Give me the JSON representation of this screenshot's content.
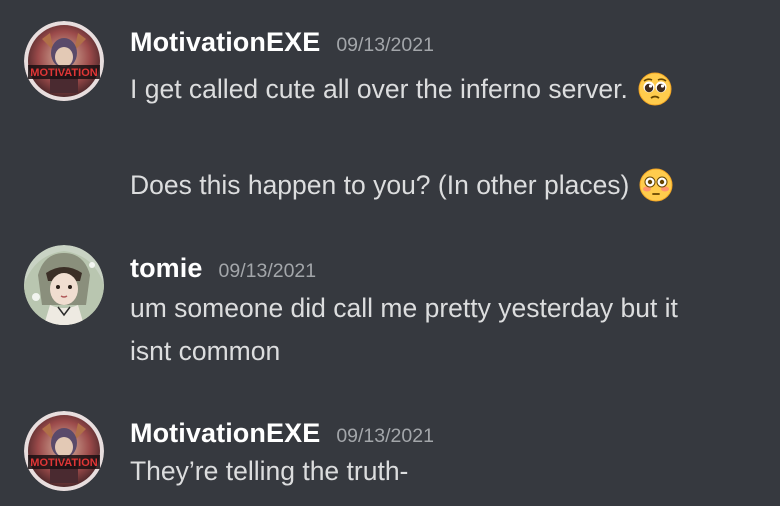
{
  "messages": [
    {
      "username": "MotivationEXE",
      "timestamp": "09/13/2021",
      "avatar_icon": "motivation-avatar-icon",
      "avatar_text": "MOTIVATION",
      "lines": [
        {
          "text": "I get called cute all over the inferno server.",
          "emoji": "pleading-face-emoji"
        },
        {
          "text": "Does this happen to you? (In other places)",
          "emoji": "flushed-face-emoji"
        }
      ]
    },
    {
      "username": "tomie",
      "timestamp": "09/13/2021",
      "avatar_icon": "tomie-avatar-icon",
      "lines": [
        {
          "text": "um someone did call me pretty yesterday but it"
        },
        {
          "text": "isnt common"
        }
      ]
    },
    {
      "username": "MotivationEXE",
      "timestamp": "09/13/2021",
      "avatar_icon": "motivation-avatar-icon",
      "avatar_text": "MOTIVATION",
      "lines": [
        {
          "text": "They’re telling the truth-"
        }
      ]
    }
  ],
  "colors": {
    "background": "#36393f",
    "username": "#ffffff",
    "timestamp": "#a3a6aa",
    "message_text": "#dcddde"
  }
}
